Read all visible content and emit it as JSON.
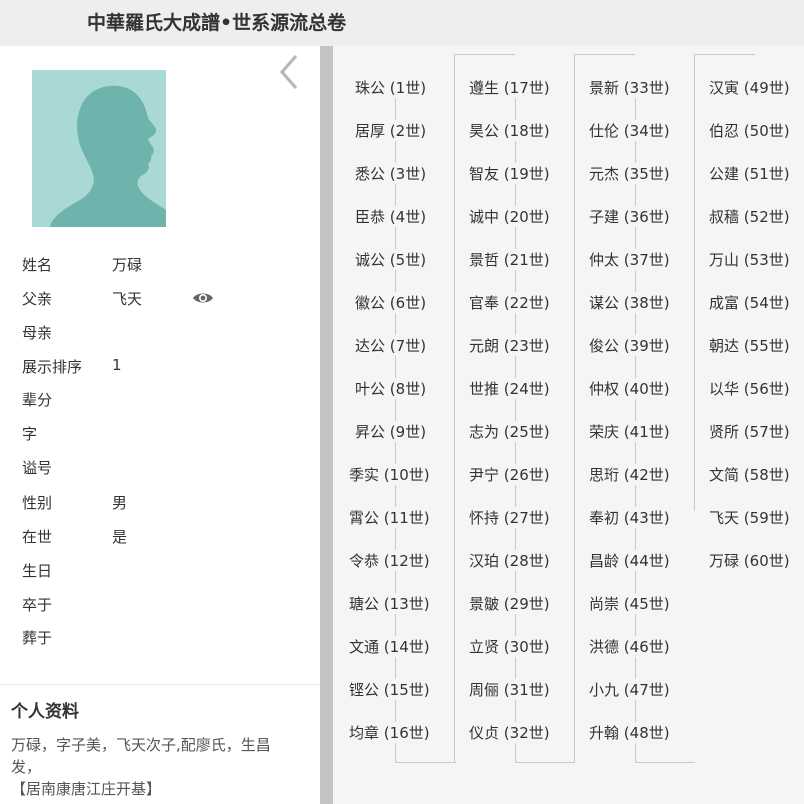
{
  "header": {
    "title": "中華羅氏大成譜•世系源流总卷"
  },
  "profile": {
    "fields": [
      {
        "key": "姓名",
        "value": "万碌"
      },
      {
        "key": "父亲",
        "value": "飞天"
      },
      {
        "key": "母亲",
        "value": ""
      },
      {
        "key": "展示排序",
        "value": "1"
      },
      {
        "key": "辈分",
        "value": ""
      },
      {
        "key": "字",
        "value": ""
      },
      {
        "key": "谥号",
        "value": ""
      },
      {
        "key": "性别",
        "value": "男"
      },
      {
        "key": "在世",
        "value": "是"
      },
      {
        "key": "生日",
        "value": ""
      },
      {
        "key": "卒于",
        "value": ""
      },
      {
        "key": "葬于",
        "value": ""
      }
    ]
  },
  "personal": {
    "title": "个人资料",
    "bio_lines": [
      "万碌，字子美，飞天次子,配廖氏，生昌",
      "发，",
      "【居南康唐江庄开基】"
    ]
  },
  "generations": [
    {
      "name": "珠公",
      "gen": "(1世)"
    },
    {
      "name": "居厚",
      "gen": "(2世)"
    },
    {
      "name": "悉公",
      "gen": "(3世)"
    },
    {
      "name": "臣恭",
      "gen": "(4世)"
    },
    {
      "name": "诚公",
      "gen": "(5世)"
    },
    {
      "name": "徽公",
      "gen": "(6世)"
    },
    {
      "name": "达公",
      "gen": "(7世)"
    },
    {
      "name": "叶公",
      "gen": "(8世)"
    },
    {
      "name": "昇公",
      "gen": "(9世)"
    },
    {
      "name": "季实",
      "gen": "(10世)"
    },
    {
      "name": "霄公",
      "gen": "(11世)"
    },
    {
      "name": "令恭",
      "gen": "(12世)"
    },
    {
      "name": "瑭公",
      "gen": "(13世)"
    },
    {
      "name": "文通",
      "gen": "(14世)"
    },
    {
      "name": "铿公",
      "gen": "(15世)"
    },
    {
      "name": "均章",
      "gen": "(16世)"
    },
    {
      "name": "遵生",
      "gen": "(17世)"
    },
    {
      "name": "昊公",
      "gen": "(18世)"
    },
    {
      "name": "智友",
      "gen": "(19世)"
    },
    {
      "name": "诚中",
      "gen": "(20世)"
    },
    {
      "name": "景哲",
      "gen": "(21世)"
    },
    {
      "name": "官奉",
      "gen": "(22世)"
    },
    {
      "name": "元朗",
      "gen": "(23世)"
    },
    {
      "name": "世推",
      "gen": "(24世)"
    },
    {
      "name": "志为",
      "gen": "(25世)"
    },
    {
      "name": "尹宁",
      "gen": "(26世)"
    },
    {
      "name": "怀持",
      "gen": "(27世)"
    },
    {
      "name": "汉珀",
      "gen": "(28世)"
    },
    {
      "name": "景皺",
      "gen": "(29世)"
    },
    {
      "name": "立贤",
      "gen": "(30世)"
    },
    {
      "name": "周俪",
      "gen": "(31世)"
    },
    {
      "name": "仪贞",
      "gen": "(32世)"
    },
    {
      "name": "景新",
      "gen": "(33世)"
    },
    {
      "name": "仕伦",
      "gen": "(34世)"
    },
    {
      "name": "元杰",
      "gen": "(35世)"
    },
    {
      "name": "子建",
      "gen": "(36世)"
    },
    {
      "name": "仲太",
      "gen": "(37世)"
    },
    {
      "name": "谋公",
      "gen": "(38世)"
    },
    {
      "name": "俊公",
      "gen": "(39世)"
    },
    {
      "name": "仲权",
      "gen": "(40世)"
    },
    {
      "name": "荣庆",
      "gen": "(41世)"
    },
    {
      "name": "思珩",
      "gen": "(42世)"
    },
    {
      "name": "奉初",
      "gen": "(43世)"
    },
    {
      "name": "昌龄",
      "gen": "(44世)"
    },
    {
      "name": "尚崇",
      "gen": "(45世)"
    },
    {
      "name": "洪德",
      "gen": "(46世)"
    },
    {
      "name": "小九",
      "gen": "(47世)"
    },
    {
      "name": "升翰",
      "gen": "(48世)"
    },
    {
      "name": "汉寅",
      "gen": "(49世)"
    },
    {
      "name": "伯忍",
      "gen": "(50世)"
    },
    {
      "name": "公建",
      "gen": "(51世)"
    },
    {
      "name": "叔穑",
      "gen": "(52世)"
    },
    {
      "name": "万山",
      "gen": "(53世)"
    },
    {
      "name": "成富",
      "gen": "(54世)"
    },
    {
      "name": "朝达",
      "gen": "(55世)"
    },
    {
      "name": "以华",
      "gen": "(56世)"
    },
    {
      "name": "贤所",
      "gen": "(57世)"
    },
    {
      "name": "文简",
      "gen": "(58世)"
    },
    {
      "name": "飞天",
      "gen": "(59世)"
    },
    {
      "name": "万碌",
      "gen": "(60世)"
    }
  ]
}
